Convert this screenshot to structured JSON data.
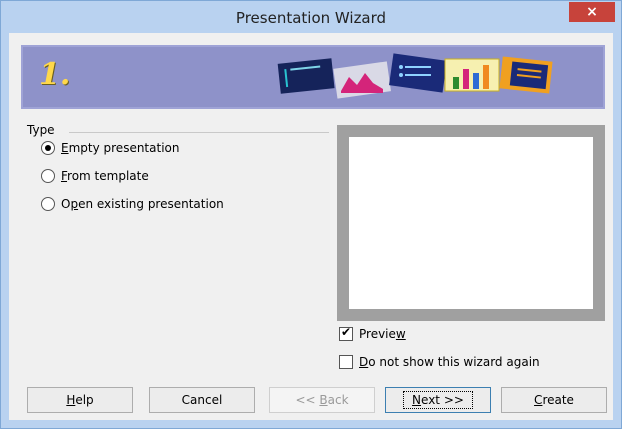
{
  "window": {
    "title": "Presentation Wizard",
    "close_label": "×"
  },
  "banner": {
    "step_number": "1."
  },
  "type_group": {
    "label": "Type",
    "options": [
      {
        "label_pre": "",
        "mnemonic": "E",
        "label_post": "mpty presentation",
        "selected": true
      },
      {
        "label_pre": "",
        "mnemonic": "F",
        "label_post": "rom template",
        "selected": false
      },
      {
        "label_pre": "O",
        "mnemonic": "p",
        "label_post": "en existing presentation",
        "selected": false
      }
    ]
  },
  "checkboxes": {
    "preview": {
      "label_pre": "Previe",
      "mnemonic": "w",
      "label_post": "",
      "checked": true
    },
    "do_not_show": {
      "label_pre": "",
      "mnemonic": "D",
      "label_post": "o not show this wizard again",
      "checked": false
    }
  },
  "buttons": {
    "help": {
      "pre": "",
      "mnemonic": "H",
      "post": "elp"
    },
    "cancel": {
      "label": "Cancel"
    },
    "back": {
      "pre": "<< ",
      "mnemonic": "B",
      "post": "ack"
    },
    "next": {
      "pre": "",
      "mnemonic": "N",
      "post": "ext >>"
    },
    "create": {
      "pre": "",
      "mnemonic": "C",
      "post": "reate"
    }
  },
  "colors": {
    "titlebar": "#b9d2f0",
    "banner": "#8e92c9",
    "close": "#c7433b",
    "step_number": "#ffd84a"
  }
}
